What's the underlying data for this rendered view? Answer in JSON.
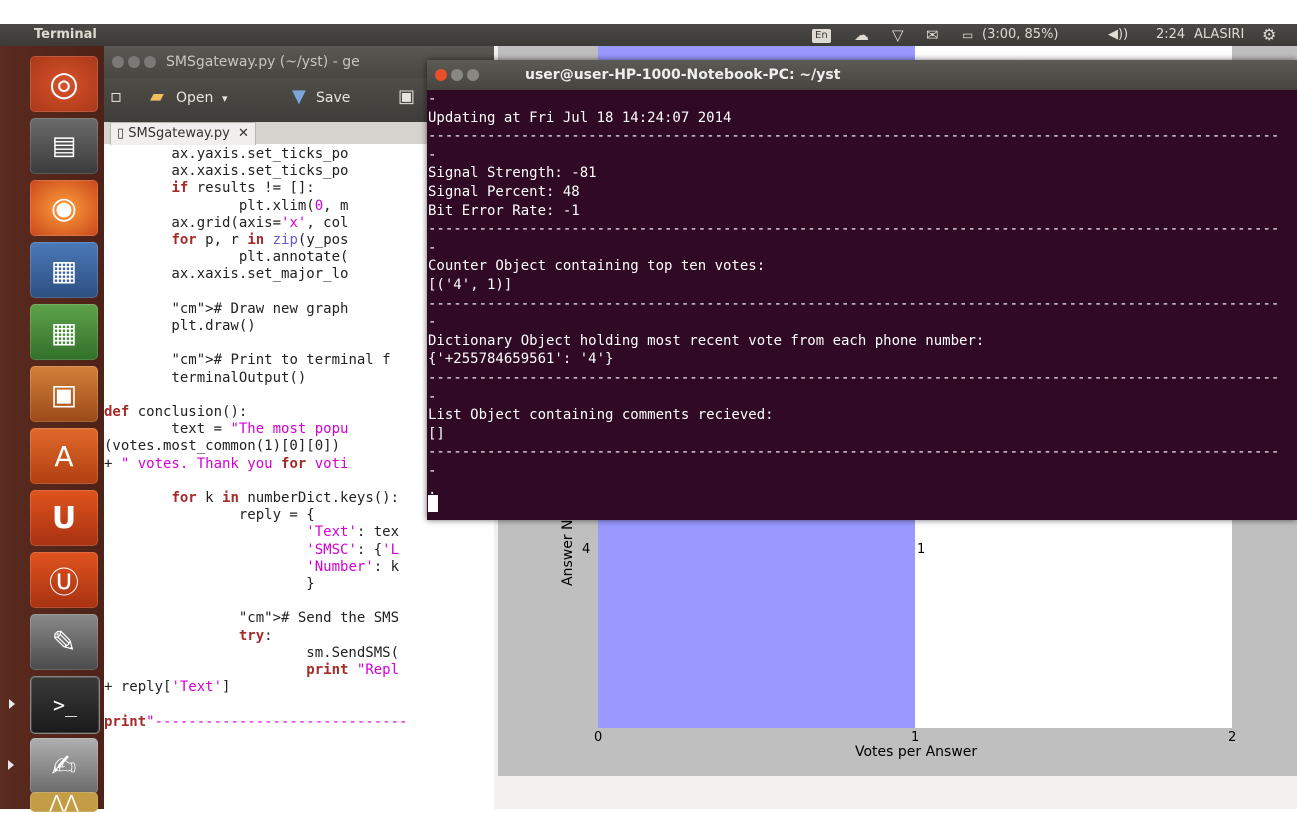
{
  "panel": {
    "title": "Terminal",
    "keyboard": "En",
    "battery": "(3:00, 85%)",
    "clock": "2:24",
    "user": "ALASIRI"
  },
  "gedit": {
    "title": "SMSgateway.py (~/yst) - ge",
    "open_label": "Open",
    "save_label": "Save",
    "tab_label": "SMSgateway.py",
    "code": [
      "        ax.yaxis.set_ticks_po",
      "        ax.xaxis.set_ticks_po",
      "        if results != []:",
      "                plt.xlim(0, m",
      "        ax.grid(axis='x', col",
      "        for p, r in zip(y_pos",
      "                plt.annotate(",
      "        ax.xaxis.set_major_lo",
      "",
      "        # Draw new graph",
      "        plt.draw()",
      "",
      "        # Print to terminal f",
      "        terminalOutput()",
      "",
      "def conclusion():",
      "        text = \"The most popu",
      "(votes.most_common(1)[0][0])",
      "+ \" votes. Thank you for voti",
      "",
      "        for k in numberDict.keys():",
      "                reply = {",
      "                        'Text': tex",
      "                        'SMSC': {'L",
      "                        'Number': k",
      "                        }",
      "",
      "                # Send the SMS",
      "                try:",
      "                        sm.SendSMS(",
      "                        print \"Repl",
      "+ reply['Text']",
      "",
      "print\"------------------------------"
    ]
  },
  "terminal": {
    "title": "user@user-HP-1000-Notebook-PC: ~/yst",
    "lines": [
      "-",
      "Updating at Fri Jul 18 14:24:07 2014",
      "-----------------------------------------------------------------------------------------------------",
      "-",
      "Signal Strength: -81",
      "Signal Percent: 48",
      "Bit Error Rate: -1",
      "-----------------------------------------------------------------------------------------------------",
      "-",
      "Counter Object containing top ten votes:",
      "[('4', 1)]",
      "-----------------------------------------------------------------------------------------------------",
      "-",
      "Dictionary Object holding most recent vote from each phone number:",
      "{'+255784659561': '4'}",
      "-----------------------------------------------------------------------------------------------------",
      "-",
      "List Object containing comments recieved:",
      "[]",
      "-----------------------------------------------------------------------------------------------------",
      "-",
      "."
    ]
  },
  "plot": {
    "xlabel": "Votes per Answer",
    "ylabel": "Answer N",
    "x_ticks": [
      "0",
      "1",
      "2"
    ],
    "y_tick": "4",
    "annotation": "1",
    "bar_color": "#9999ff"
  },
  "chart_data": {
    "type": "bar",
    "orientation": "horizontal",
    "categories": [
      "4"
    ],
    "values": [
      1
    ],
    "xlabel": "Votes per Answer",
    "ylabel": "Answer N",
    "xlim": [
      0,
      2
    ],
    "x_ticks": [
      0,
      1,
      2
    ],
    "annotations": [
      "1"
    ]
  }
}
